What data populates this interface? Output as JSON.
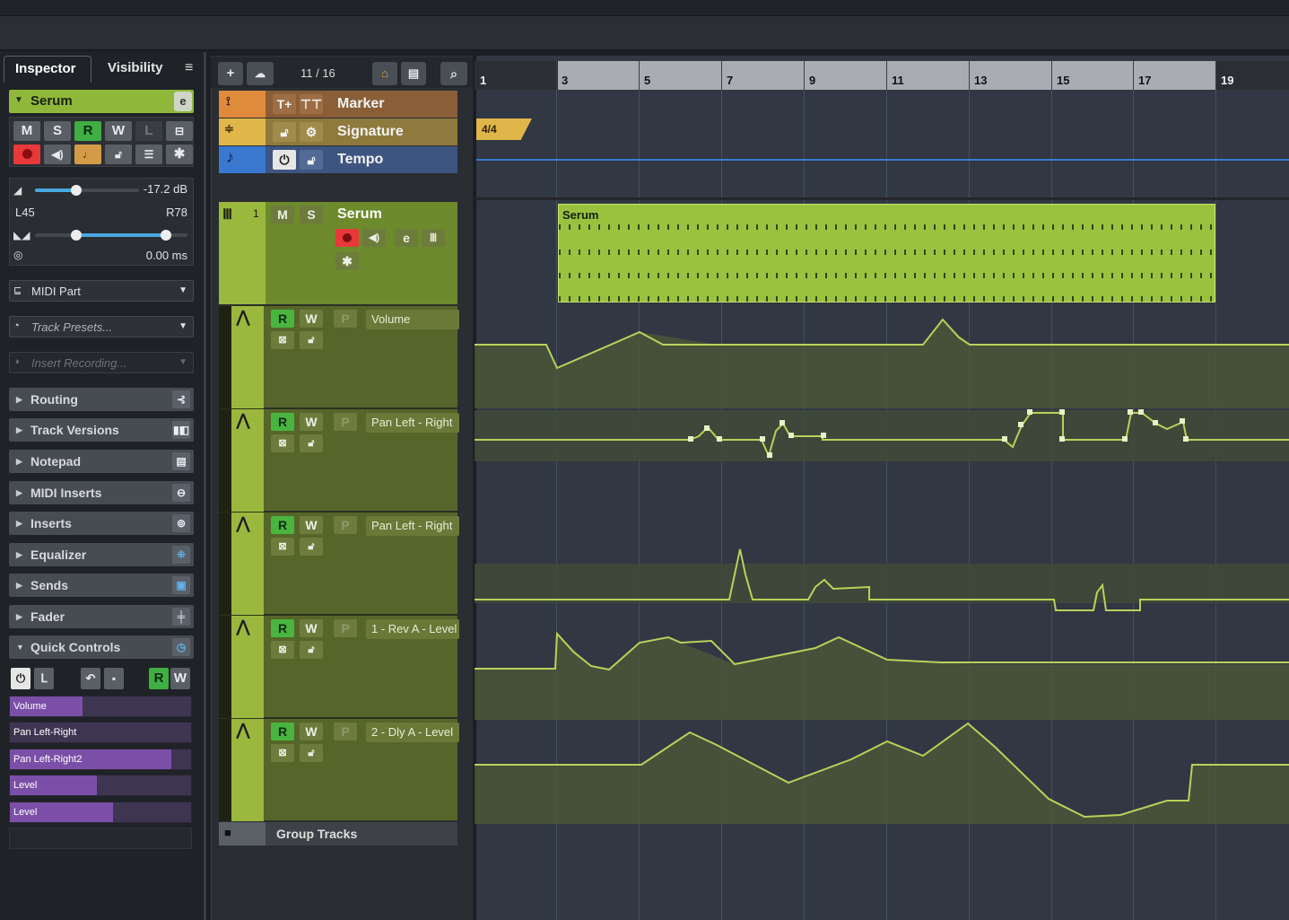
{
  "inspector": {
    "tabs": [
      "Inspector",
      "Visibility"
    ],
    "menu_glyph": "≡",
    "track_name": "Serum",
    "buttons_row1": [
      "M",
      "S",
      "R",
      "W",
      "L"
    ],
    "volume": "-17.2 dB",
    "pan_left": "L45",
    "pan_right": "R78",
    "delay": "0.00 ms",
    "midi_part": "MIDI Part",
    "track_presets_placeholder": "Track Presets...",
    "insert_recording_placeholder": "Insert Recording...",
    "sections": [
      "Routing",
      "Track Versions",
      "Notepad",
      "MIDI Inserts",
      "Inserts",
      "Equalizer",
      "Sends",
      "Fader",
      "Quick Controls"
    ],
    "qc_rw": [
      "R",
      "W"
    ],
    "quick_controls": [
      {
        "label": "Volume",
        "level": 0.4
      },
      {
        "label": "Pan Left-Right",
        "level": 0.0
      },
      {
        "label": "Pan Left-Right2",
        "level": 0.89
      },
      {
        "label": "Level",
        "level": 0.48
      },
      {
        "label": "Level",
        "level": 0.57
      }
    ]
  },
  "toolbar": {
    "counter": "11 / 16"
  },
  "global_tracks": [
    {
      "label": "Marker",
      "color": "#e08a3c"
    },
    {
      "label": "Signature",
      "color": "#e0b64a"
    },
    {
      "label": "Tempo",
      "color": "#3a78d0"
    }
  ],
  "instrument_track": {
    "number": "1",
    "name": "Serum",
    "m": "M",
    "s": "S"
  },
  "automation_tracks": [
    {
      "param": "Volume",
      "r": "R",
      "w": "W",
      "p": "P"
    },
    {
      "param": "Pan Left - Right",
      "r": "R",
      "w": "W",
      "p": "P"
    },
    {
      "param": "Pan Left - Right",
      "r": "R",
      "w": "W",
      "p": "P"
    },
    {
      "param": "1 - Rev A - Level",
      "r": "R",
      "w": "W",
      "p": "P"
    },
    {
      "param": "2 - Dly A - Level",
      "r": "R",
      "w": "W",
      "p": "P"
    }
  ],
  "group_tracks_label": "Group Tracks",
  "ruler": {
    "bars": [
      "1",
      "3",
      "5",
      "7",
      "9",
      "11",
      "13",
      "15",
      "17",
      "19"
    ]
  },
  "signature_event": "4/4",
  "midi_part_label": "Serum",
  "colors": {
    "track_green": "#9ab83e",
    "automation_line": "#b8d25a",
    "cycle": "#a9adb3"
  }
}
